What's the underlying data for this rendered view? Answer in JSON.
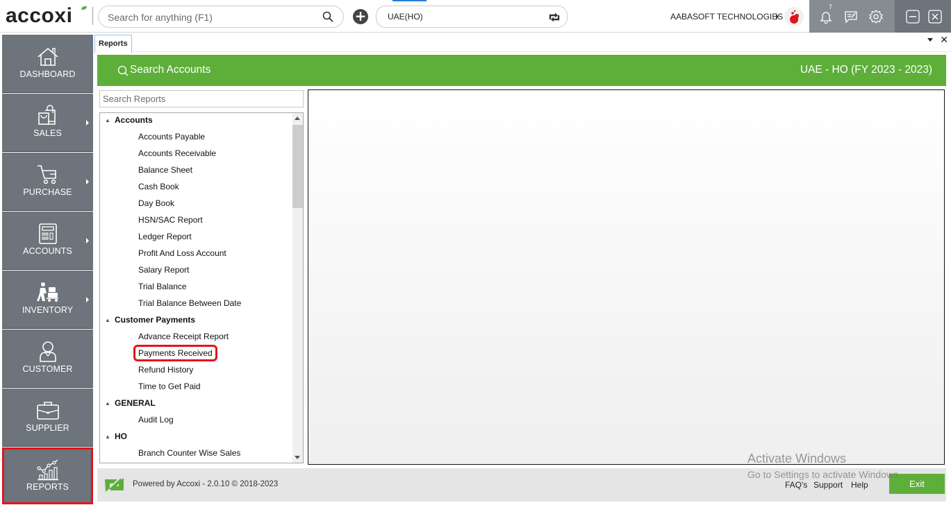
{
  "app": {
    "logo_text": "accoxi",
    "search": {
      "placeholder": "Search for anything (F1)",
      "value": ""
    },
    "branch_selector": {
      "value": "UAE(HO)"
    },
    "company": {
      "name": "AABASOFT TECHNOLOGIES"
    },
    "notifications": {
      "count": "7"
    },
    "icons": {
      "search": "search-icon",
      "add": "plus-circle-icon",
      "sync": "sync-icon",
      "notifications": "bell-icon",
      "messages": "chat-edit-icon",
      "settings": "gear-icon",
      "minimize": "minimize-icon",
      "close": "close-icon"
    },
    "colors": {
      "accent_green": "#5eae3a",
      "sidebar_bg": "#6d747b",
      "highlight_red": "#e0151b",
      "tray_bg": "#878c91"
    }
  },
  "sidebar": {
    "items": [
      {
        "label": "DASHBOARD",
        "icon": "home-icon",
        "has_submenu": false,
        "highlighted": false
      },
      {
        "label": "SALES",
        "icon": "shopping-bags-icon",
        "has_submenu": true,
        "highlighted": false
      },
      {
        "label": "PURCHASE",
        "icon": "cart-icon",
        "has_submenu": true,
        "highlighted": false
      },
      {
        "label": "ACCOUNTS",
        "icon": "calculator-icon",
        "has_submenu": true,
        "highlighted": false
      },
      {
        "label": "INVENTORY",
        "icon": "trolley-worker-icon",
        "has_submenu": true,
        "highlighted": false
      },
      {
        "label": "CUSTOMER",
        "icon": "user-icon",
        "has_submenu": false,
        "highlighted": false
      },
      {
        "label": "SUPPLIER",
        "icon": "briefcase-icon",
        "has_submenu": false,
        "highlighted": false
      },
      {
        "label": "REPORTS",
        "icon": "chart-icon",
        "has_submenu": false,
        "highlighted": true
      }
    ]
  },
  "tabs": {
    "active": "Reports",
    "items": [
      {
        "label": "Reports"
      }
    ]
  },
  "header": {
    "search_accounts_label": "Search Accounts",
    "fiscal_label": "UAE - HO (FY 2023 - 2023)"
  },
  "reports": {
    "search": {
      "placeholder": "Search Reports",
      "value": ""
    },
    "groups": [
      {
        "name": "Accounts",
        "items": [
          "Accounts Payable",
          "Accounts Receivable",
          "Balance Sheet",
          "Cash Book",
          "Day Book",
          "HSN/SAC Report",
          "Ledger Report",
          "Profit And Loss Account",
          "Salary Report",
          "Trial Balance",
          "Trial Balance Between Date"
        ]
      },
      {
        "name": "Customer Payments",
        "items": [
          "Advance Receipt Report",
          "Payments Received",
          "Refund History",
          "Time to Get Paid"
        ]
      },
      {
        "name": "GENERAL",
        "items": [
          "Audit Log"
        ]
      },
      {
        "name": "HO",
        "items": [
          "Branch Counter Wise Sales"
        ]
      }
    ],
    "selected_item": "Payments Received"
  },
  "footer": {
    "powered_by": "Powered by Accoxi - 2.0.10 © 2018-2023",
    "links": [
      "FAQ's",
      "Support",
      "Help"
    ],
    "exit_label": "Exit"
  },
  "watermark": {
    "line1": "Activate Windows",
    "line2": "Go to Settings to activate Windows."
  }
}
